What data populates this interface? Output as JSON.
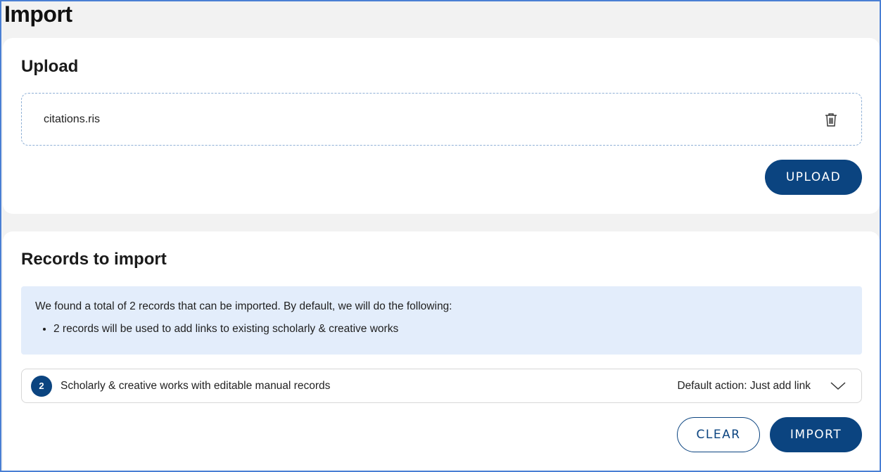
{
  "page": {
    "title": "Import"
  },
  "upload": {
    "heading": "Upload",
    "file_name": "citations.ris",
    "delete_icon": "trash-icon",
    "upload_label": "UPLOAD"
  },
  "records": {
    "heading": "Records to import",
    "info": {
      "summary": "We found a total of 2 records that can be imported. By default, we will do the following:",
      "bullets": [
        "2 records will be used to add links to existing scholarly & creative works"
      ]
    },
    "group": {
      "count": "2",
      "label": "Scholarly & creative works with editable manual records",
      "default_action": "Default action: Just add link",
      "expand_icon": "chevron-down-icon"
    },
    "clear_label": "CLEAR",
    "import_label": "IMPORT"
  },
  "colors": {
    "primary": "#0b4480",
    "info_background": "#e3edfb",
    "page_background": "#f2f2f2"
  }
}
